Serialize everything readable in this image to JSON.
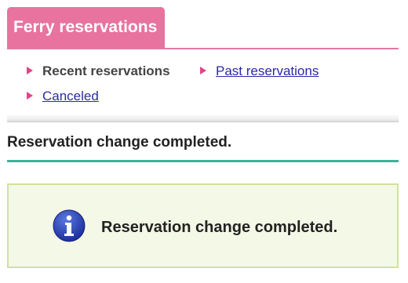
{
  "header": {
    "tab_label": "Ferry reservations"
  },
  "nav": {
    "current_label": "Recent reservations",
    "past_label": "Past reservations",
    "canceled_label": "Canceled"
  },
  "main": {
    "title": "Reservation change completed.",
    "message": "Reservation change completed.",
    "message_icon": "info-icon"
  },
  "colors": {
    "tab_background": "#e8739f",
    "nav_arrow": "#e0468a",
    "title_underline": "#3bb39a",
    "message_background": "#f4f8e6",
    "message_border": "#cfe39a",
    "link": "#2a2aa6"
  }
}
